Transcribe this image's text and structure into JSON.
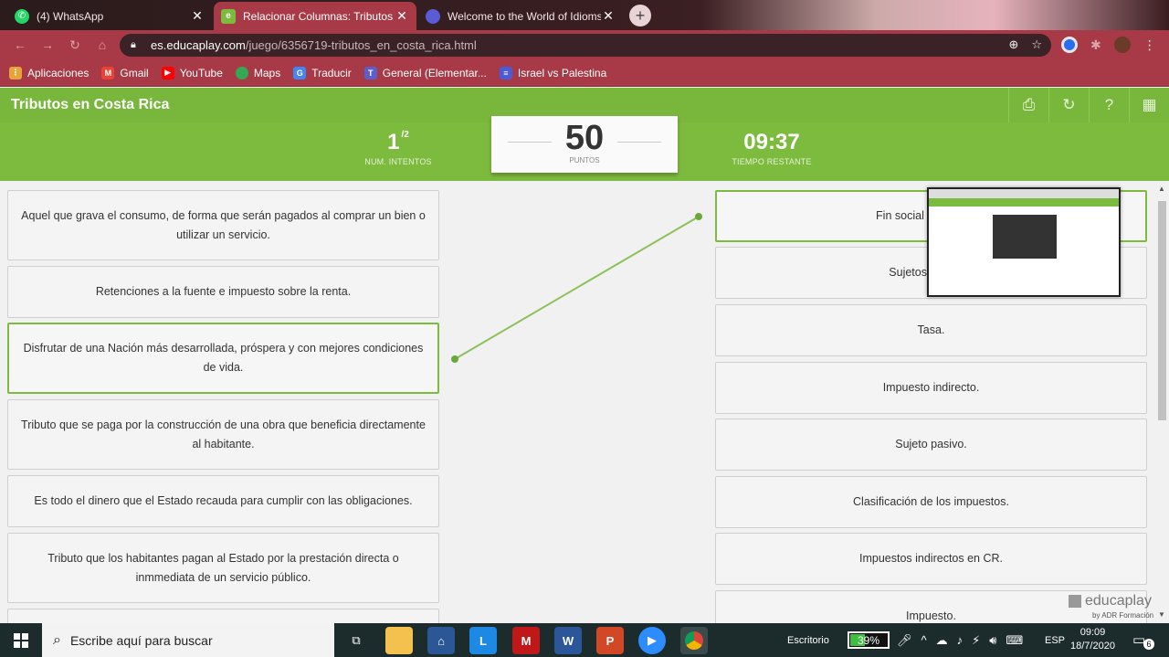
{
  "browser": {
    "tabs": [
      {
        "title": "(4) WhatsApp",
        "icon": "whatsapp-icon",
        "color": "#25d366"
      },
      {
        "title": "Relacionar Columnas: Tributos en",
        "icon": "educaplay-icon",
        "color": "#7dbb3f"
      },
      {
        "title": "Welcome to the World of Idioms",
        "icon": "globe-icon",
        "color": "#5b5bd6"
      }
    ],
    "new_tab": "+",
    "url_host": "es.educaplay.com",
    "url_path": "/juego/6356719-tributos_en_costa_rica.html",
    "bookmarks": [
      {
        "label": "Aplicaciones",
        "icon": "apps-icon",
        "color": "#e8a33a"
      },
      {
        "label": "Gmail",
        "icon": "gmail-icon",
        "color": "#ea4335"
      },
      {
        "label": "YouTube",
        "icon": "youtube-icon",
        "color": "#ff0000"
      },
      {
        "label": "Maps",
        "icon": "maps-icon",
        "color": "#34a853"
      },
      {
        "label": "Traducir",
        "icon": "translate-icon",
        "color": "#4285f4"
      },
      {
        "label": "General (Elementar...",
        "icon": "teams-icon",
        "color": "#5b5fc7"
      },
      {
        "label": "Israel vs Palestina",
        "icon": "forms-icon",
        "color": "#4a5bd6"
      }
    ]
  },
  "game": {
    "title": "Tributos en Costa Rica",
    "attempts": "1",
    "attempts_total": "/2",
    "attempts_label": "NUM. INTENTOS",
    "score": "50",
    "score_label": "PUNTOS",
    "time": "09:37",
    "time_label": "TIEMPO RESTANTE",
    "accent_color": "#7dbb3f",
    "left_items": [
      "Aquel que grava el consumo, de forma que serán pagados al comprar un bien o utilizar un servicio.",
      "Retenciones a la fuente e impuesto sobre la renta.",
      "Disfrutar de una Nación más desarrollada, próspera y con mejores condiciones de vida.",
      "Tributo que se paga por la construcción de una obra que beneficia directamente al habitante.",
      "Es todo el dinero que el Estado recauda para cumplir con las obligaciones.",
      "Tributo que los habitantes pagan al Estado por la prestación directa o inmmediata de un servicio público.",
      ""
    ],
    "right_items": [
      "Fin social que cumple",
      "Sujetos de la obl",
      "Tasa.",
      "Impuesto indirecto.",
      "Sujeto pasivo.",
      "Clasificación de los impuestos.",
      "Impuestos indirectos en CR.",
      "Impuesto."
    ],
    "brand": "educaplay",
    "brand_sub": "by ADR Formación"
  },
  "taskbar": {
    "search_placeholder": "Escribe aquí para buscar",
    "desktop_label": "Escritorio",
    "battery": "39%",
    "language": "ESP",
    "time": "09:09",
    "date": "18/7/2020",
    "notifications": "6"
  }
}
